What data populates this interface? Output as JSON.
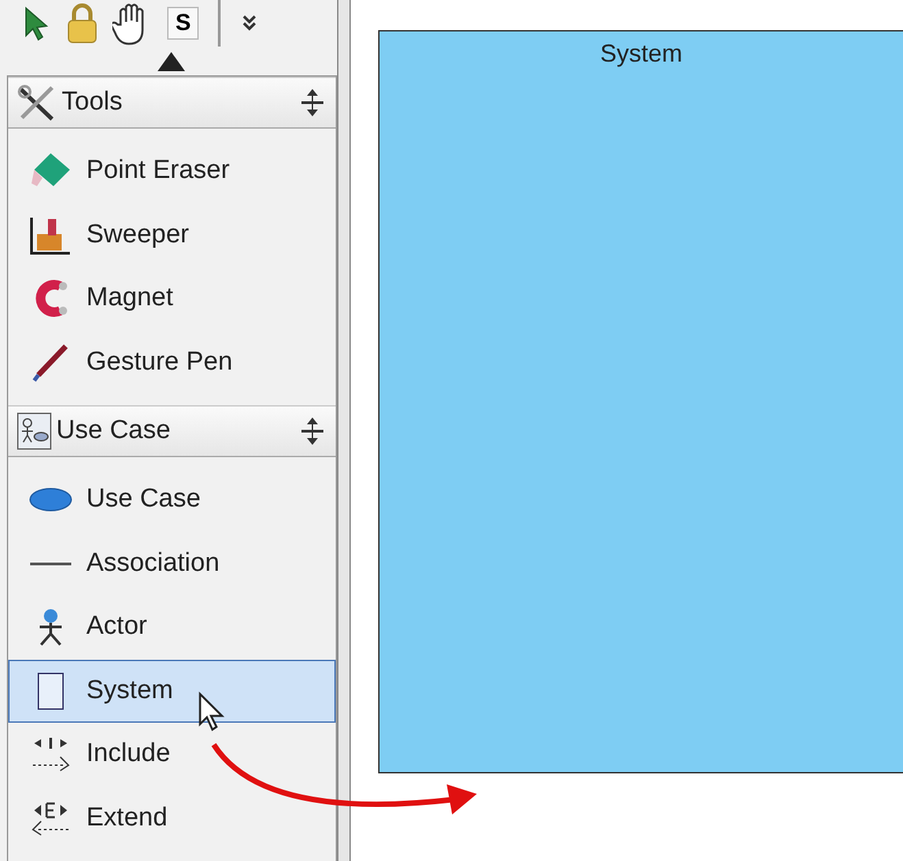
{
  "toolbar": {
    "items": [
      {
        "kind": "select"
      },
      {
        "kind": "lock"
      },
      {
        "kind": "hand"
      },
      {
        "kind": "key",
        "label": "S"
      },
      {
        "kind": "more"
      }
    ]
  },
  "sections": [
    {
      "title": "Tools",
      "kind": "tools",
      "items": [
        {
          "label": "Point Eraser",
          "kind": "eraser",
          "selected": false
        },
        {
          "label": "Sweeper",
          "kind": "sweeper",
          "selected": false
        },
        {
          "label": "Magnet",
          "kind": "magnet",
          "selected": false
        },
        {
          "label": "Gesture Pen",
          "kind": "pen",
          "selected": false
        }
      ]
    },
    {
      "title": "Use Case",
      "kind": "usecase",
      "items": [
        {
          "label": "Use Case",
          "kind": "ellipse",
          "selected": false
        },
        {
          "label": "Association",
          "kind": "line",
          "selected": false
        },
        {
          "label": "Actor",
          "kind": "actor",
          "selected": false
        },
        {
          "label": "System",
          "kind": "system",
          "selected": true
        },
        {
          "label": "Include",
          "kind": "include",
          "selected": false
        },
        {
          "label": "Extend",
          "kind": "extend",
          "selected": false
        }
      ]
    }
  ],
  "canvas": {
    "system": {
      "title": "System"
    }
  }
}
